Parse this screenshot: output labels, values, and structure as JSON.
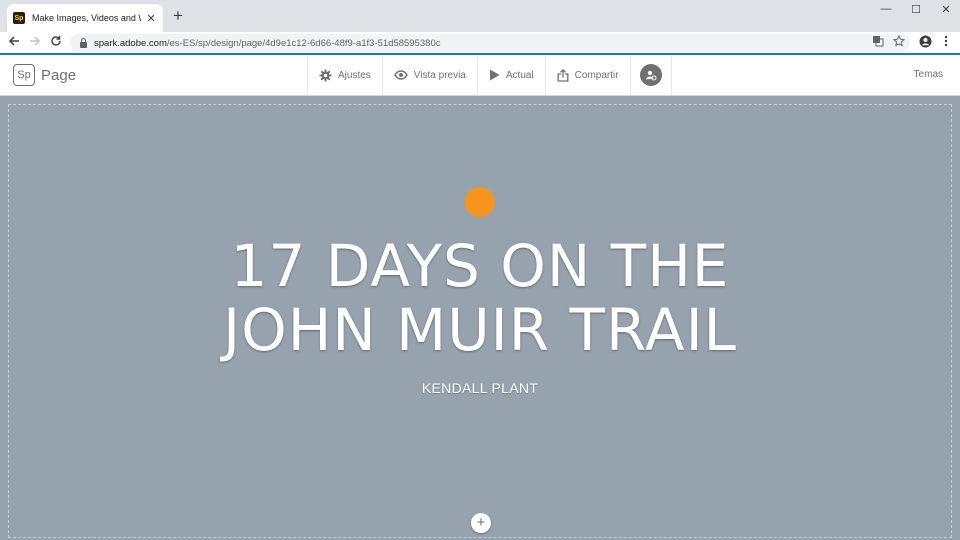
{
  "browser": {
    "tab": {
      "favicon_text": "Sp",
      "title": "Make Images, Videos and Web S",
      "close": "✕"
    },
    "new_tab": "+",
    "window_controls": {
      "minimize": "—",
      "maximize": "☐",
      "close": "✕"
    },
    "address": {
      "host": "spark.adobe.com",
      "path": "/es-ES/sp/design/page/4d9e1c12-6d66-48f9-a1f3-51d58595380c"
    }
  },
  "app": {
    "logo": {
      "badge": "Sp",
      "name": "Page"
    },
    "nav": [
      {
        "label": "Ajustes",
        "icon": "gear-icon"
      },
      {
        "label": "Vista previa",
        "icon": "eye-icon"
      },
      {
        "label": "Actual",
        "icon": "play-icon"
      },
      {
        "label": "Compartir",
        "icon": "share-icon"
      }
    ],
    "right_link": "Temas"
  },
  "page": {
    "title_line1": "17 DAYS ON THE",
    "title_line2": "JOHN MUIR TRAIL",
    "subtitle": "KENDALL PLANT",
    "add_button": "+"
  },
  "colors": {
    "canvas_bg": "#96a2ae",
    "accent_orange": "#f7941d",
    "progress_blue": "#1473e6"
  }
}
